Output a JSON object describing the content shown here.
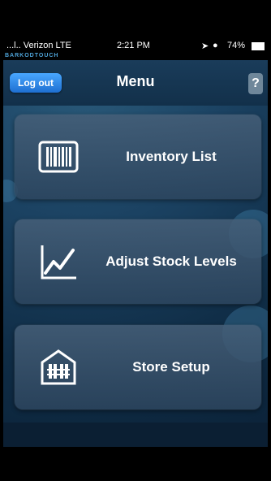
{
  "status": {
    "carrier": "...l.. Verizon  LTE",
    "time": "2:21 PM",
    "battery": "74%"
  },
  "brand": "BARKODTOUCH",
  "navbar": {
    "logout_label": "Log out",
    "title": "Menu",
    "help_label": "?"
  },
  "menu": {
    "items": [
      {
        "label": "Inventory List",
        "icon": "barcode-icon"
      },
      {
        "label": "Adjust Stock Levels",
        "icon": "chart-trend-icon"
      },
      {
        "label": "Store Setup",
        "icon": "warehouse-icon"
      }
    ]
  },
  "colors": {
    "accent": "#1e6fd1",
    "background": "#1b4262"
  }
}
